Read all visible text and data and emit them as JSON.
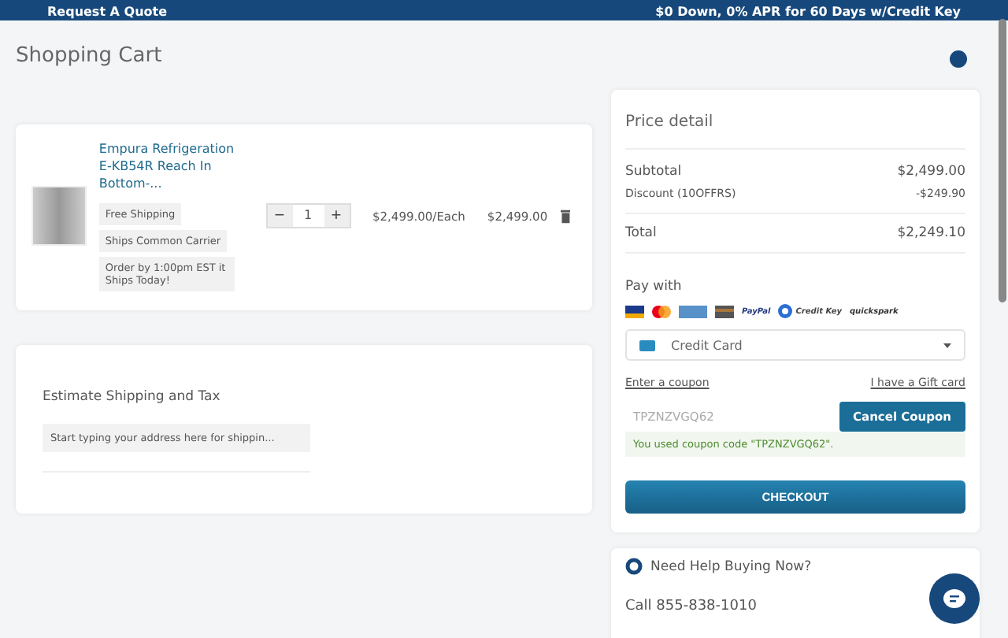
{
  "top_bar": {
    "link": "Request A Quote",
    "promo": "$0 Down, 0% APR for 60 Days w/Credit Key"
  },
  "title": "Shopping Cart",
  "cart_items": [
    {
      "name": "Empura Refrigeration E-KB54R Reach In Bottom-...",
      "tags": [
        "Free Shipping",
        "Ships Common Carrier",
        "Order by 1:00pm EST it Ships Today!"
      ],
      "decrement": "−",
      "quantity": "1",
      "increment": "+",
      "unit_price": "$2,499.00/Each",
      "line_total": "$2,499.00"
    }
  ],
  "shipping_estimate": {
    "title": "Estimate Shipping and Tax",
    "placeholder": "Start typing your address here for shippin..."
  },
  "price_detail": {
    "title": "Price detail",
    "rows": [
      {
        "kind": "subtotal",
        "label": "Subtotal",
        "value": "$2,499.00"
      },
      {
        "kind": "discount",
        "label": "Discount (10OFFRS)",
        "value": "-$249.90"
      },
      {
        "kind": "total",
        "label": "Total",
        "value": "$2,249.10"
      }
    ],
    "pay_with": "Pay with",
    "payment_logos": [
      {
        "kind": "visa"
      },
      {
        "kind": "mastercard"
      },
      {
        "kind": "amex"
      },
      {
        "kind": "card"
      },
      {
        "kind": "text",
        "label": "PayPal",
        "color": "#253b80"
      },
      {
        "kind": "creditkey",
        "label": "Credit Key",
        "color": "#444444"
      },
      {
        "kind": "text",
        "label": "quickspark",
        "color": "#333333"
      }
    ],
    "payment_method": "Credit Card",
    "coupon_link": "Enter a coupon",
    "gift_link": "I have a Gift card",
    "coupon_value": "TPZNZVGQ62",
    "cancel_button": "Cancel Coupon",
    "coupon_message": "You used coupon code \"TPZNZVGQ62\".",
    "checkout": "CHECKOUT"
  },
  "help": {
    "title": "Need Help Buying Now?",
    "phone": "Call 855-838-1010"
  }
}
